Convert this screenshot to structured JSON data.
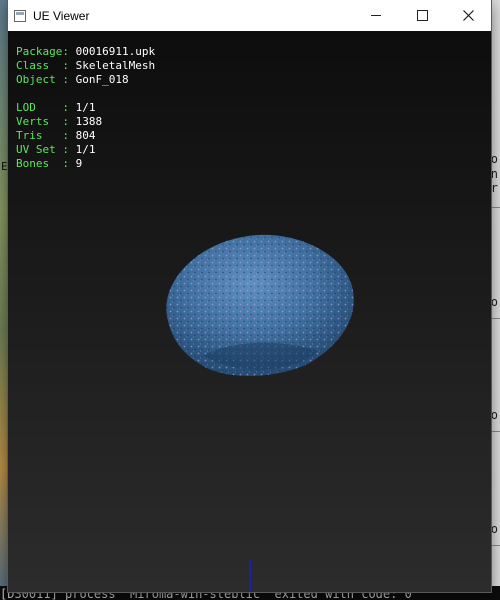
{
  "window": {
    "title": "UE Viewer",
    "buttons": {
      "minimize": "minimize",
      "maximize": "maximize",
      "close": "close"
    }
  },
  "info": {
    "package": {
      "label": "Package",
      "value": "00016911.upk"
    },
    "class": {
      "label": "Class  ",
      "value": "SkeletalMesh"
    },
    "object": {
      "label": "Object ",
      "value": "GonF_018"
    },
    "lod": {
      "label": "LOD    ",
      "value": "1/1"
    },
    "verts": {
      "label": "Verts  ",
      "value": "1388"
    },
    "tris": {
      "label": "Tris   ",
      "value": "804"
    },
    "uvset": {
      "label": "UV Set ",
      "value": "1/1"
    },
    "bones": {
      "label": "Bones  ",
      "value": "9"
    }
  },
  "background_console": {
    "line": "[D30011] process \"Miroma-win-steblic\" exited with code: 0"
  },
  "colors": {
    "label": "#5ce65c",
    "value": "#ffffff",
    "mesh": "#3f6f9e",
    "mesh_speckle": "#b79adf"
  },
  "icons": [
    "app-icon",
    "minimize-icon",
    "maximize-icon",
    "close-icon"
  ]
}
